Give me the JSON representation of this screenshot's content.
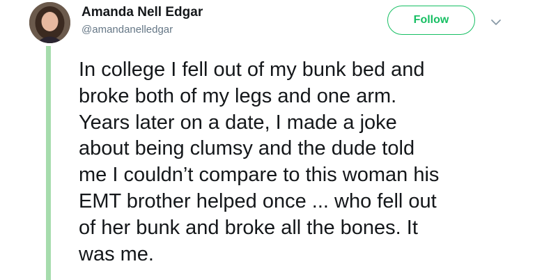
{
  "author": {
    "display_name": "Amanda Nell Edgar",
    "handle": "@amandanelledgar",
    "avatar_icon": "profile-photo"
  },
  "actions": {
    "follow_label": "Follow",
    "more_icon": "chevron-down-icon"
  },
  "tweet": {
    "lines": [
      "In college I fell out of my bunk bed and",
      "broke both of my legs and one arm.",
      "Years later on a date, I made a joke",
      "about being clumsy and the dude told",
      "me I couldn’t compare to this woman his",
      "EMT brother helped once ... who fell out",
      "of her bunk and broke all the bones. It",
      "was me."
    ]
  },
  "colors": {
    "follow_accent": "#17bf63",
    "thread_line": "#a6dcad",
    "handle_gray": "#657786",
    "text": "#14171a"
  }
}
